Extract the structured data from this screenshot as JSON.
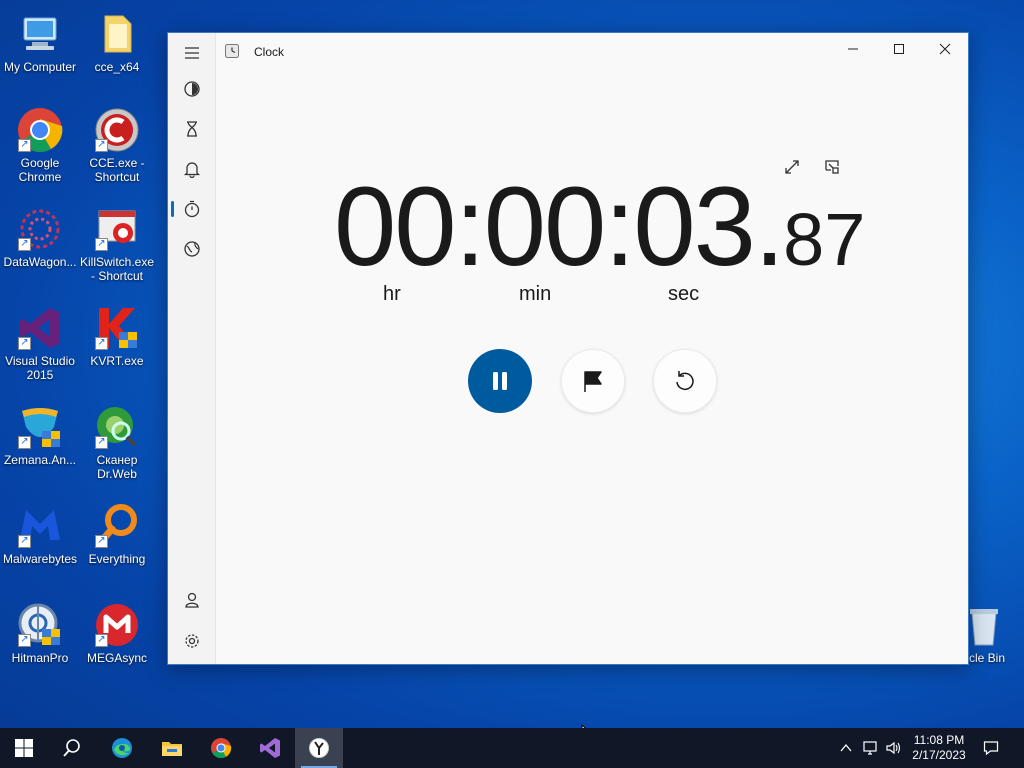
{
  "desktop": {
    "icons": [
      {
        "label": "My Computer"
      },
      {
        "label": "cce_x64"
      },
      {
        "label": "Google Chrome"
      },
      {
        "label": "CCE.exe - Shortcut"
      },
      {
        "label": "DataWagon..."
      },
      {
        "label": "KillSwitch.exe - Shortcut"
      },
      {
        "label": "Visual Studio 2015"
      },
      {
        "label": "KVRT.exe"
      },
      {
        "label": "Zemana.An..."
      },
      {
        "label": "Сканер Dr.Web"
      },
      {
        "label": "Malwarebytes"
      },
      {
        "label": "Everything"
      },
      {
        "label": "HitmanPro"
      },
      {
        "label": "MEGAsync"
      },
      {
        "label": "ycle Bin"
      }
    ]
  },
  "window": {
    "title": "Clock",
    "accent": "#005a9e"
  },
  "stopwatch": {
    "main": "00:00:03.",
    "ms": "87",
    "units": {
      "hr": "hr",
      "min": "min",
      "sec": "sec"
    }
  },
  "taskbar": {
    "time": "11:08 PM",
    "date": "2/17/2023"
  }
}
